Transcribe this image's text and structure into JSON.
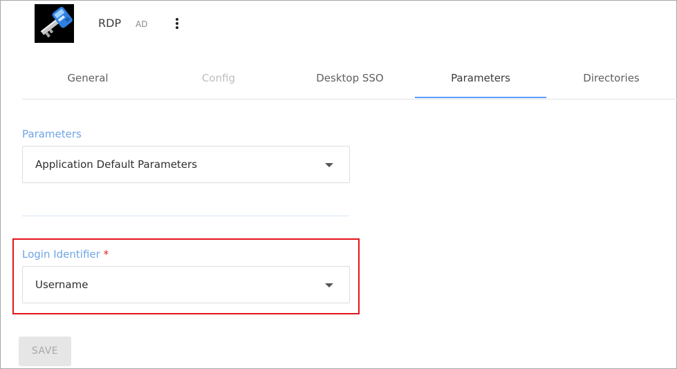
{
  "app": {
    "name": "RDP",
    "type_badge": "AD",
    "icon": "key-icon",
    "menu_icon": "more-vertical-icon"
  },
  "tabs": [
    {
      "label": "General",
      "state": "normal"
    },
    {
      "label": "Config",
      "state": "disabled"
    },
    {
      "label": "Desktop SSO",
      "state": "normal"
    },
    {
      "label": "Parameters",
      "state": "active"
    },
    {
      "label": "Directories",
      "state": "normal"
    }
  ],
  "parameters_field": {
    "label": "Parameters",
    "value": "Application Default Parameters"
  },
  "login_identifier_field": {
    "label": "Login Identifier",
    "required_mark": "*",
    "value": "Username"
  },
  "save_button": {
    "label": "SAVE",
    "disabled": true
  },
  "colors": {
    "accent": "#5a9cff",
    "label_blue": "#6fa4e8",
    "highlight_red": "#e3121b",
    "required_red": "#e0202a"
  }
}
